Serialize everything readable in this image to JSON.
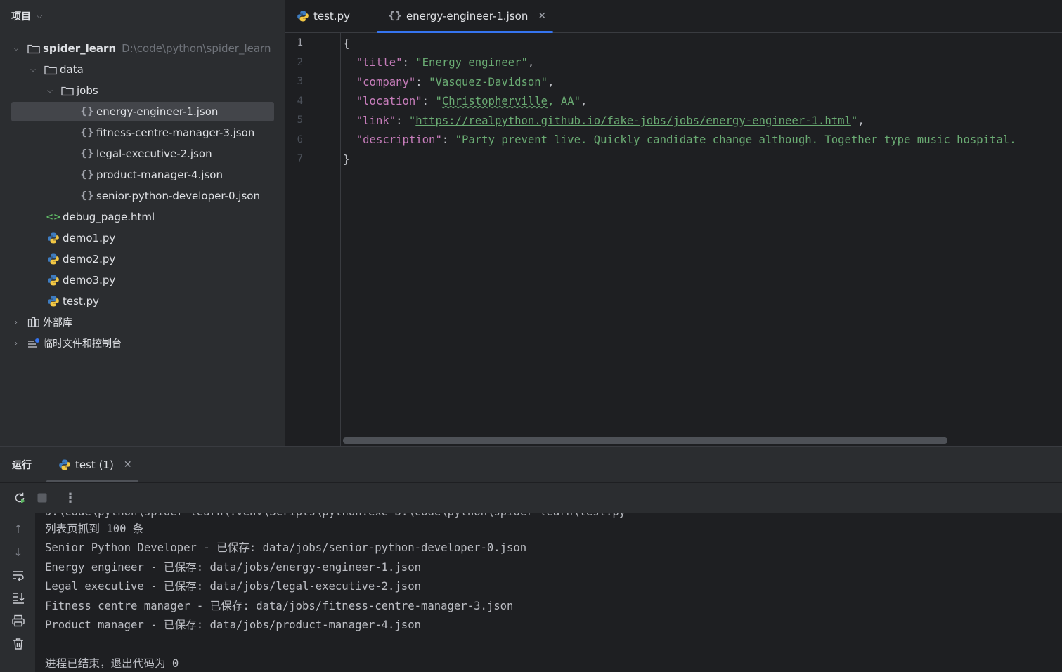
{
  "project": {
    "title": "项目",
    "root": {
      "name": "spider_learn",
      "path": "D:\\code\\python\\spider_learn"
    },
    "folders": {
      "data": "data",
      "jobs": "jobs"
    },
    "json_files": [
      "energy-engineer-1.json",
      "fitness-centre-manager-3.json",
      "legal-executive-2.json",
      "product-manager-4.json",
      "senior-python-developer-0.json"
    ],
    "html_file": "debug_page.html",
    "py_files": [
      "demo1.py",
      "demo2.py",
      "demo3.py",
      "test.py"
    ],
    "external_libs": "外部库",
    "scratches": "临时文件和控制台"
  },
  "editor": {
    "tabs": [
      {
        "label": "test.py",
        "icon": "python-icon"
      },
      {
        "label": "energy-engineer-1.json",
        "icon": "json-icon",
        "active": true
      }
    ],
    "line_numbers": [
      "1",
      "2",
      "3",
      "4",
      "5",
      "6",
      "7"
    ],
    "json": {
      "open": "{",
      "close": "}",
      "title_key": "\"title\"",
      "title_val": "\"Energy engineer\"",
      "company_key": "\"company\"",
      "company_val": "\"Vasquez-Davidson\"",
      "location_key": "\"location\"",
      "location_q": "\"",
      "location_city": "Christopherville",
      "location_rest": ", AA\"",
      "link_key": "\"link\"",
      "link_q1": "\"",
      "link_url": "https://realpython.github.io/fake-jobs/jobs/energy-engineer-1.html",
      "link_q2": "\"",
      "desc_key": "\"description\"",
      "desc_val": "\"Party prevent live. Quickly candidate change although. Together type music hospital."
    }
  },
  "run": {
    "title": "运行",
    "tab_label": "test (1)",
    "console_clipped": "D:\\code\\python\\spider_learn\\.venv\\Scripts\\python.exe D:\\code\\python\\spider_learn\\test.py",
    "console_lines": [
      "列表页抓到 100 条",
      "Senior Python Developer - 已保存: data/jobs/senior-python-developer-0.json",
      "Energy engineer - 已保存: data/jobs/energy-engineer-1.json",
      "Legal executive - 已保存: data/jobs/legal-executive-2.json",
      "Fitness centre manager - 已保存: data/jobs/fitness-centre-manager-3.json",
      "Product manager - 已保存: data/jobs/product-manager-4.json"
    ],
    "exit_line": "进程已结束，退出代码为 0"
  },
  "colors": {
    "accent": "#3574f0",
    "json_key": "#c77dbb",
    "json_string": "#6aab73",
    "panel_bg": "#2b2d30",
    "editor_bg": "#1e1f22"
  }
}
